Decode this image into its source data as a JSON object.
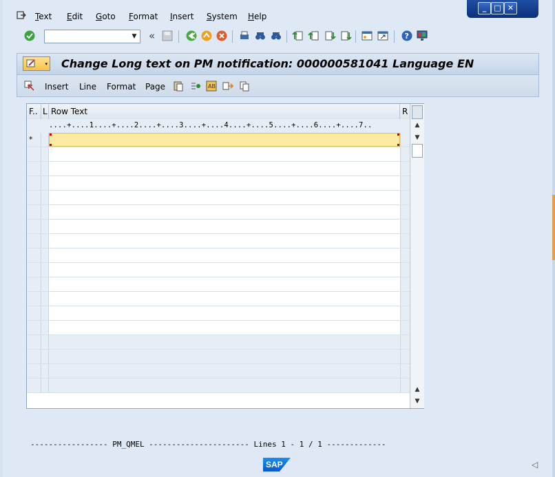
{
  "menu": {
    "items": [
      {
        "label": "Text",
        "ul": "T"
      },
      {
        "label": "Edit",
        "ul": "E"
      },
      {
        "label": "Goto",
        "ul": "G"
      },
      {
        "label": "Format",
        "ul": "F"
      },
      {
        "label": "Insert",
        "ul": "I"
      },
      {
        "label": "System",
        "ul": "S"
      },
      {
        "label": "Help",
        "ul": "H"
      }
    ]
  },
  "toolbar": {
    "command_field_value": "",
    "back_chevron": "«"
  },
  "title": "Change Long text on PM notification: 000000581041 Language EN",
  "app_toolbar": {
    "insert": "Insert",
    "line": "Line",
    "format": "Format",
    "page": "Page"
  },
  "table": {
    "headers": {
      "f": "F..",
      "l": "L",
      "row_text": "Row Text",
      "r": "R"
    },
    "ruler": "....+....1....+....2....+....3....+....4....+....5....+....6....+....7..",
    "first_row_flag": "*",
    "row_count": 14
  },
  "footer": "----------------- PM_QMEL ---------------------- Lines 1 - 1 / 1 -------------",
  "sap_logo": "SAP",
  "colors": {
    "active_row": "#fdeba1",
    "title_button": "#f6c24a",
    "window_controls": "#143f91"
  }
}
